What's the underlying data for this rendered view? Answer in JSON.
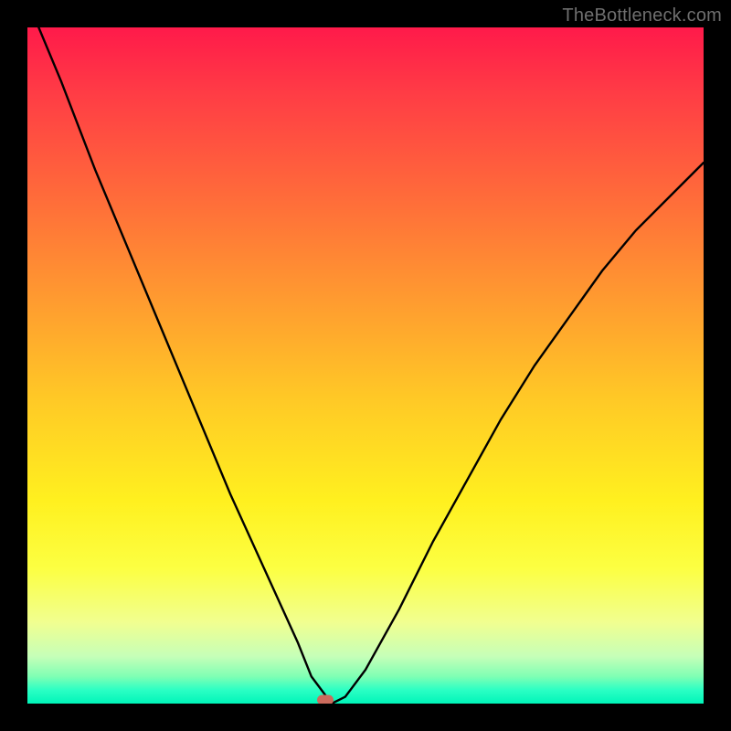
{
  "attribution": "TheBottleneck.com",
  "chart_data": {
    "type": "line",
    "title": "",
    "xlabel": "",
    "ylabel": "",
    "xlim": [
      0,
      100
    ],
    "ylim": [
      0,
      100
    ],
    "x": [
      0,
      5,
      10,
      15,
      20,
      25,
      30,
      35,
      40,
      42,
      45,
      47,
      50,
      55,
      60,
      65,
      70,
      75,
      80,
      85,
      90,
      95,
      100
    ],
    "values": [
      104,
      92,
      79,
      67,
      55,
      43,
      31,
      20,
      9,
      4,
      0,
      1,
      5,
      14,
      24,
      33,
      42,
      50,
      57,
      64,
      70,
      75,
      80
    ],
    "marker": {
      "x": 44,
      "y": 0
    },
    "gradient_stops": [
      {
        "pos": 0,
        "color": "#ff1a4a"
      },
      {
        "pos": 25,
        "color": "#ff6b3a"
      },
      {
        "pos": 55,
        "color": "#ffc926"
      },
      {
        "pos": 80,
        "color": "#fcff42"
      },
      {
        "pos": 96,
        "color": "#7fffb4"
      },
      {
        "pos": 100,
        "color": "#00f5b9"
      }
    ]
  }
}
